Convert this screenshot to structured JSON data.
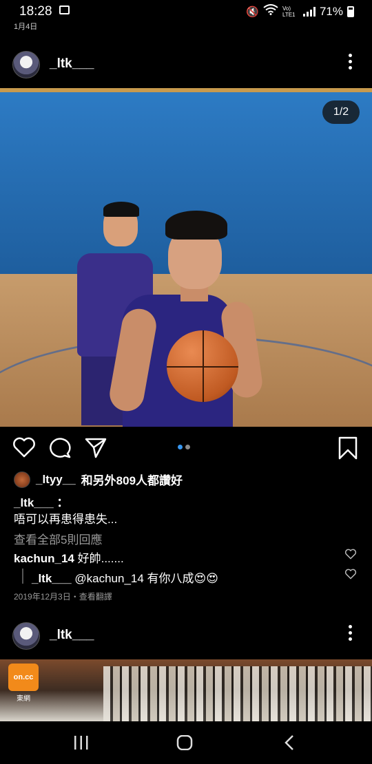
{
  "status_bar": {
    "time": "18:28",
    "date": "1月4日",
    "battery": "71%",
    "network": "Vo) LTE1"
  },
  "post1": {
    "username": "_ltk___",
    "image_counter": "1/2",
    "carousel": {
      "active_index": 0,
      "count": 2
    },
    "liked_by": "_ltyy__",
    "likes_text": "和另外809人都讚好",
    "caption_user": "_ltk___ ：",
    "caption_text": "唔可以再患得患失...",
    "view_all_comments": "查看全部5則回應",
    "comment": {
      "user": "kachun_14",
      "text": " 好帥......."
    },
    "reply": {
      "user": "_ltk___",
      "text": " @kachun_14 有你八成😍😍"
    },
    "meta": "2019年12月3日・查看翻譯"
  },
  "post2": {
    "username": "_ltk___",
    "watermark_caption": "東網",
    "watermark_logo": "on.cc"
  },
  "colors": {
    "accent": "#3897f0",
    "muted": "#9a9a9a",
    "background": "#000000"
  },
  "icons": [
    "heart-icon",
    "comment-icon",
    "share-icon",
    "bookmark-icon",
    "more-icon",
    "recents-icon",
    "home-icon",
    "back-icon"
  ]
}
